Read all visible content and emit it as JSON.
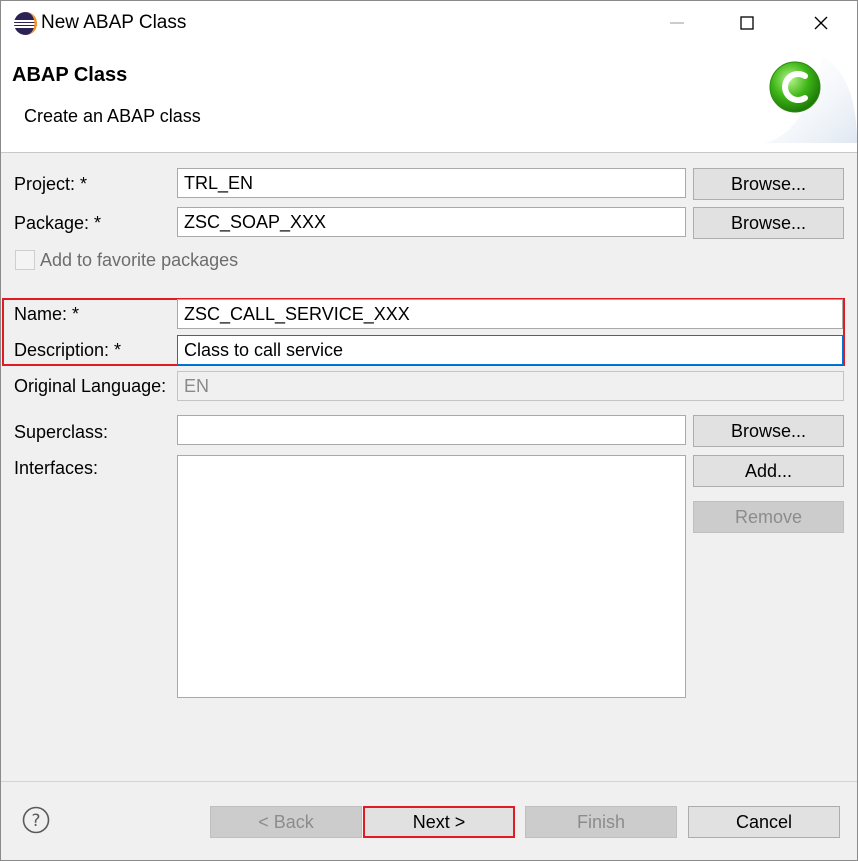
{
  "window": {
    "title": "New ABAP Class"
  },
  "header": {
    "title": "ABAP Class",
    "subtitle": "Create an ABAP class",
    "logo_icon": "abap-class-c-icon"
  },
  "form": {
    "project": {
      "label": "Project: *",
      "value": "TRL_EN",
      "browse": "Browse..."
    },
    "package": {
      "label": "Package: *",
      "value": "ZSC_SOAP_XXX",
      "browse": "Browse..."
    },
    "favorite": {
      "label": "Add to favorite packages",
      "checked": false
    },
    "name": {
      "label": "Name: *",
      "value": "ZSC_CALL_SERVICE_XXX"
    },
    "description": {
      "label": "Description: *",
      "value": "Class to call service"
    },
    "language": {
      "label": "Original Language:",
      "value": "EN"
    },
    "superclass": {
      "label": "Superclass:",
      "value": "",
      "browse": "Browse..."
    },
    "interfaces": {
      "label": "Interfaces:",
      "add": "Add...",
      "remove": "Remove",
      "items": []
    }
  },
  "footer": {
    "help_icon": "help-icon",
    "back": "< Back",
    "next": "Next >",
    "finish": "Finish",
    "cancel": "Cancel"
  },
  "colors": {
    "highlight": "#e01b24",
    "focus": "#0078d7",
    "logo_green": "#3fb618"
  }
}
